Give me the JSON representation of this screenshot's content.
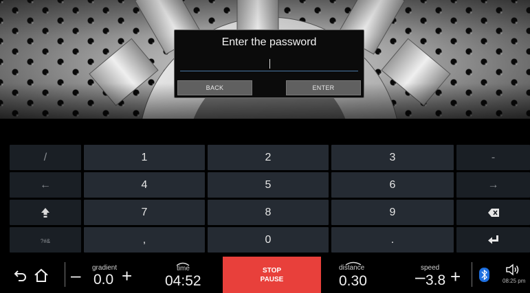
{
  "dialog": {
    "title": "Enter the password",
    "password_value": "",
    "back_label": "BACK",
    "enter_label": "ENTER"
  },
  "keypad": {
    "rows": [
      {
        "left": "/",
        "keys": [
          "1",
          "2",
          "3"
        ],
        "right": "-"
      },
      {
        "left": "←",
        "keys": [
          "4",
          "5",
          "6"
        ],
        "right": "→"
      },
      {
        "left": "shift-icon",
        "keys": [
          "7",
          "8",
          "9"
        ],
        "right": "backspace-icon"
      },
      {
        "left": "?#&",
        "keys": [
          ",",
          "0",
          "."
        ],
        "right": "enter-icon"
      }
    ]
  },
  "bar": {
    "gradient_label": "gradient",
    "gradient_value": "0.0",
    "time_label": "time",
    "time_value": "04:52",
    "stop_label": "STOP",
    "pause_label": "PAUSE",
    "distance_label": "distance",
    "distance_value": "0.30",
    "speed_label": "speed",
    "speed_value": "3.8",
    "clock": "08:25 pm",
    "minus": "–",
    "plus": "+"
  },
  "colors": {
    "stop_button": "#e8403b",
    "key_bg": "#252b33",
    "key_side_bg": "#1a1f25",
    "bluetooth": "#1d6fe0"
  }
}
